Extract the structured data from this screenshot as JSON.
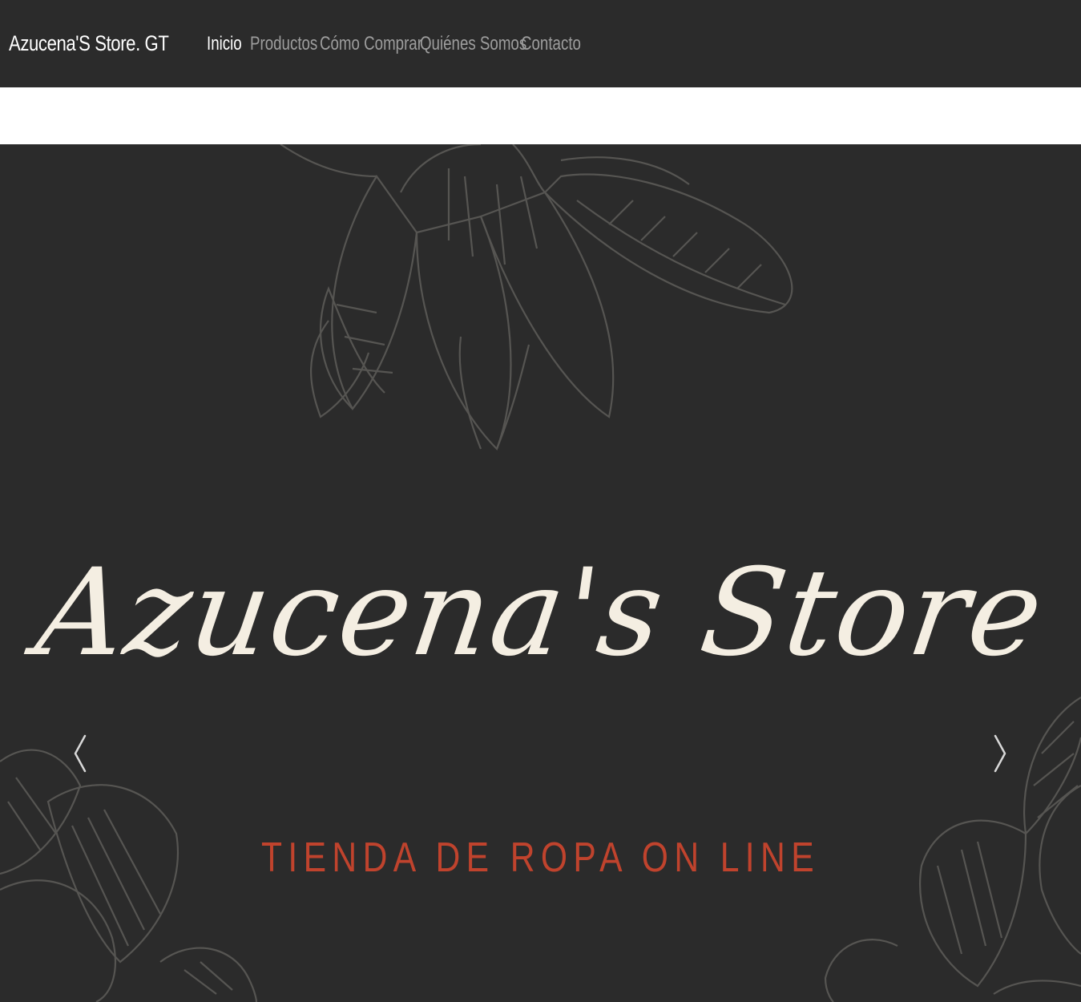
{
  "navbar": {
    "brand": "Azucena'S Store. GT",
    "links": [
      {
        "label": "Inicio",
        "active": true
      },
      {
        "label": "Productos",
        "active": false
      },
      {
        "label": "Cómo Comprar",
        "active": false
      },
      {
        "label": "Quiénes Somos",
        "active": false
      },
      {
        "label": "Contacto",
        "active": false
      }
    ]
  },
  "hero": {
    "title": "Azucena's Store",
    "tagline": "TIENDA DE ROPA ON LINE",
    "prev_icon": "chevron-left-icon",
    "next_icon": "chevron-right-icon"
  },
  "colors": {
    "navbar_bg": "#2b2b2b",
    "hero_bg": "#2b2b2b",
    "title": "#f4eee2",
    "tagline": "#c0432d",
    "nav_inactive": "#9d9d9d",
    "nav_active": "#ffffff"
  }
}
